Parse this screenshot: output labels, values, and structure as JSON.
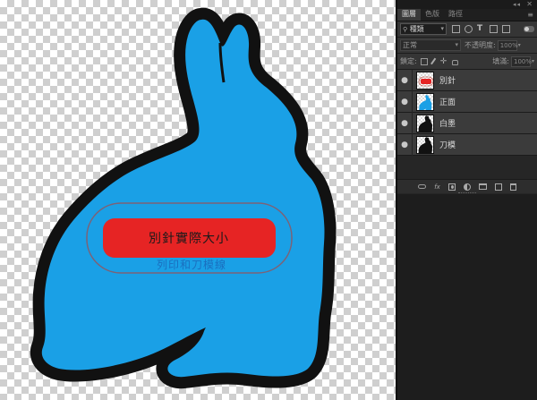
{
  "canvas": {
    "pin_label": "別針實際大小",
    "sub_label": "列印和刀模線",
    "colors": {
      "fill": "#1aa0e6",
      "outline": "#111111",
      "pin": "#e62424",
      "sub_text": "#1a6fbf"
    }
  },
  "panel": {
    "grip": "◂◂",
    "close": "✕",
    "tabs": [
      {
        "label": "圖層",
        "active": true
      },
      {
        "label": "色版",
        "active": false
      },
      {
        "label": "路徑",
        "active": false
      }
    ],
    "menu": "≡",
    "filter": {
      "kind": "種類",
      "caret": "▾"
    },
    "blend": {
      "mode": "正常",
      "caret": "▾",
      "opacity_label": "不透明度:",
      "opacity_value": "100%",
      "mini_caret": "▾"
    },
    "lock": {
      "label": "鎖定:",
      "fill_label": "填滿:",
      "fill_value": "100%",
      "mini_caret": "▾"
    },
    "layers": [
      {
        "name": "別針",
        "eye": "●",
        "thumb": "pin"
      },
      {
        "name": "正面",
        "eye": "●",
        "thumb": "blue-rabbit"
      },
      {
        "name": "白墨",
        "eye": "●",
        "thumb": "black-rabbit"
      },
      {
        "name": "刀模",
        "eye": "●",
        "thumb": "black-rabbit"
      }
    ],
    "bottom_icons": [
      "link-icon",
      "fx-icon",
      "mask-icon",
      "adjustment-icon",
      "folder-icon",
      "new-layer-icon",
      "trash-icon"
    ],
    "fx_label": "fx"
  }
}
